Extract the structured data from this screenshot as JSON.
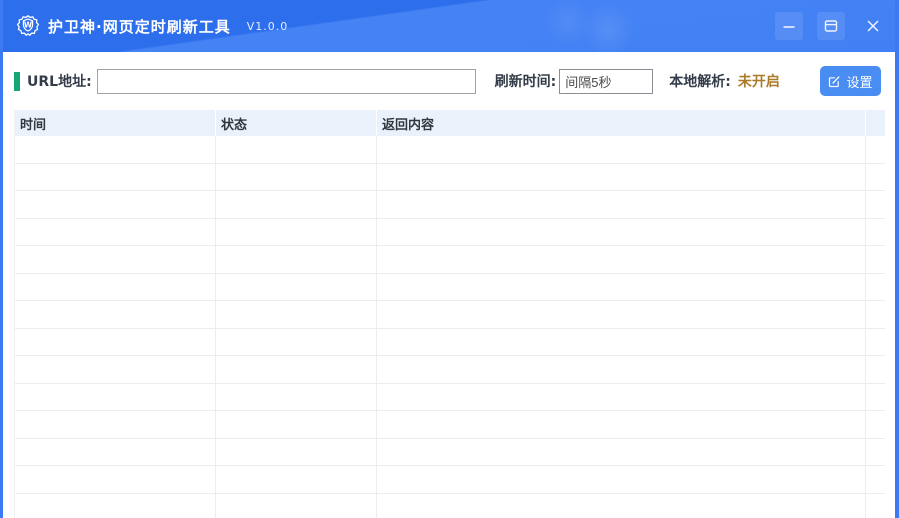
{
  "window": {
    "title": "护卫神·网页定时刷新工具",
    "version": "V1.0.0"
  },
  "toolbar": {
    "url_label": "URL地址:",
    "url_value": "",
    "url_placeholder": "",
    "refresh_label": "刷新时间:",
    "refresh_value": "间隔5秒",
    "dns_label": "本地解析:",
    "dns_status": "未开启",
    "settings_label": "设置"
  },
  "table": {
    "columns": [
      "时间",
      "状态",
      "返回内容"
    ],
    "rows": [],
    "visible_empty_rows": 14
  },
  "icons": {
    "logo": "shield-w-logo-icon",
    "settings": "edit-icon",
    "window": [
      "minimize-icon",
      "maximize-icon",
      "close-icon"
    ]
  },
  "colors": {
    "titlebar_blue_dark": "#2d6eec",
    "titlebar_blue_light": "#4583f5",
    "window_border_blue": "#3c7af3",
    "accent_green": "#16a673",
    "status_orange": "#ab7b2a",
    "settings_button_blue": "#4a8df2",
    "table_header_bg": "#e9f2fb",
    "table_grid_line": "#ededed",
    "label_text": "#333c48"
  }
}
